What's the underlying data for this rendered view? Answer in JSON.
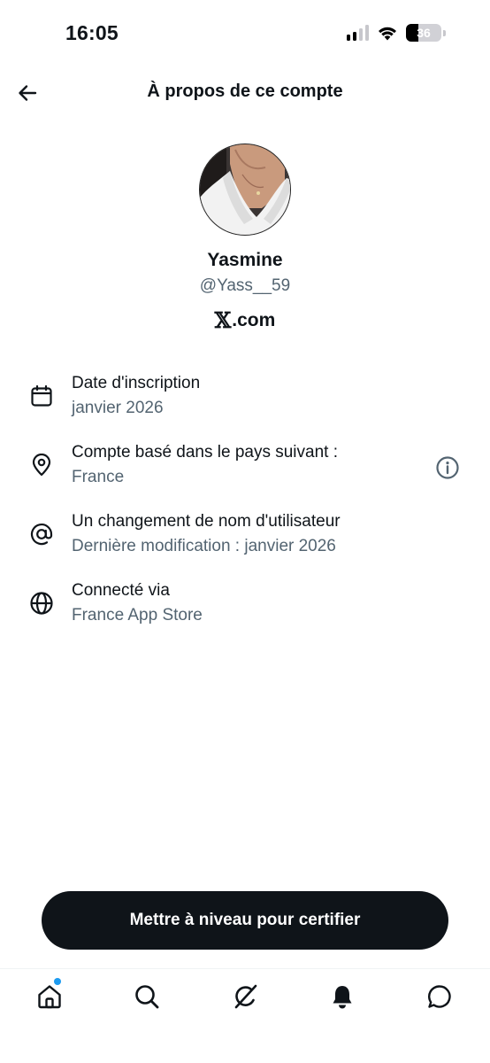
{
  "status_bar": {
    "time": "16:05",
    "battery_level": "36",
    "battery_fraction": 0.36
  },
  "header": {
    "title": "À propos de ce compte",
    "back_icon": "arrow-left-icon"
  },
  "profile": {
    "name": "Yasmine",
    "handle": "@Yass__59",
    "source_logo": "𝕏",
    "source_text": ".com"
  },
  "info": [
    {
      "icon": "calendar-icon",
      "title": "Date d'inscription",
      "value": "janvier 2026"
    },
    {
      "icon": "location-pin-icon",
      "title": "Compte basé dans le pays suivant :",
      "value": "France"
    },
    {
      "icon": "at-sign-icon",
      "title": "Un changement de nom d'utilisateur",
      "value": "Dernière modification : janvier 2026"
    },
    {
      "icon": "globe-icon",
      "title": "Connecté via",
      "value": "France App Store"
    }
  ],
  "cta": {
    "label": "Mettre à niveau pour certifier"
  },
  "tabs": [
    "home-icon",
    "search-icon",
    "grok-icon",
    "bell-icon",
    "messages-icon"
  ],
  "colors": {
    "text_primary": "#0f1419",
    "text_secondary": "#536471",
    "button_bg": "#0f1419",
    "notification_dot": "#1d9bf0"
  }
}
